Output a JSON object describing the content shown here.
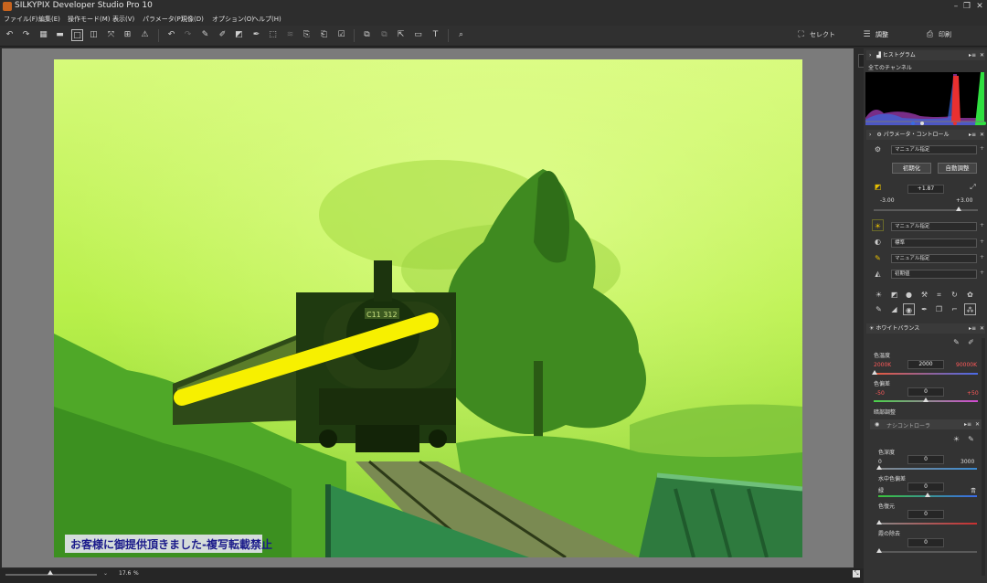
{
  "app": {
    "title": "SILKYPIX Developer Studio Pro 10"
  },
  "window": {
    "minimize": "–",
    "maximize": "❐",
    "close": "✕"
  },
  "menu": [
    "ファイル(F)",
    "編集(E)",
    "操作モード(M)",
    "表示(V)",
    "パラメータ(P)",
    "現像(D)",
    "オプション(O)",
    "ヘルプ(H)"
  ],
  "toolbar": {
    "select_label": "セレクト",
    "adjust_label": "調整",
    "print_label": "印刷"
  },
  "photo": {
    "watermark": "お客様に御提供頂きました-複写転載禁止",
    "locomotive_plate": "C11 312"
  },
  "status": {
    "zoom": "17.6",
    "zoom_unit": "%"
  },
  "histogram": {
    "title": "ヒストグラム",
    "channel": "全てのチャンネル"
  },
  "param": {
    "title": "パラメータ・コントロール",
    "taste": "マニュアル指定",
    "reset": "初期化",
    "auto": "自動調整",
    "exposure_value": "+1.87",
    "exposure_min": "-3.00",
    "exposure_max": "+3.00",
    "wb_mode": "マニュアル指定",
    "tone": "標準",
    "sharp": "マニュアル指定",
    "noise": "初期値"
  },
  "wb": {
    "title": "ホワイトバランス",
    "temp_label": "色温度",
    "temp_min": "2000K",
    "temp_value": "2000",
    "temp_max": "90000K",
    "tint_label": "色偏差",
    "tint_min": "-50",
    "tint_value": "0",
    "tint_max": "+50"
  },
  "fine": {
    "title": "暗部調整",
    "sub_title": "ナシコントローラ",
    "depth_label": "色深度",
    "depth_min": "0",
    "depth_value": "0",
    "depth_max": "3000",
    "water_label": "水中色偏差",
    "water_left": "緑",
    "water_value": "0",
    "water_right": "青",
    "restore_label": "色復元",
    "restore_value": "0",
    "haze_label": "霞の除去",
    "haze_value": "0"
  },
  "colors": {
    "photo_tint": "#b8f03c",
    "highlight_stroke": "#f7f000"
  }
}
